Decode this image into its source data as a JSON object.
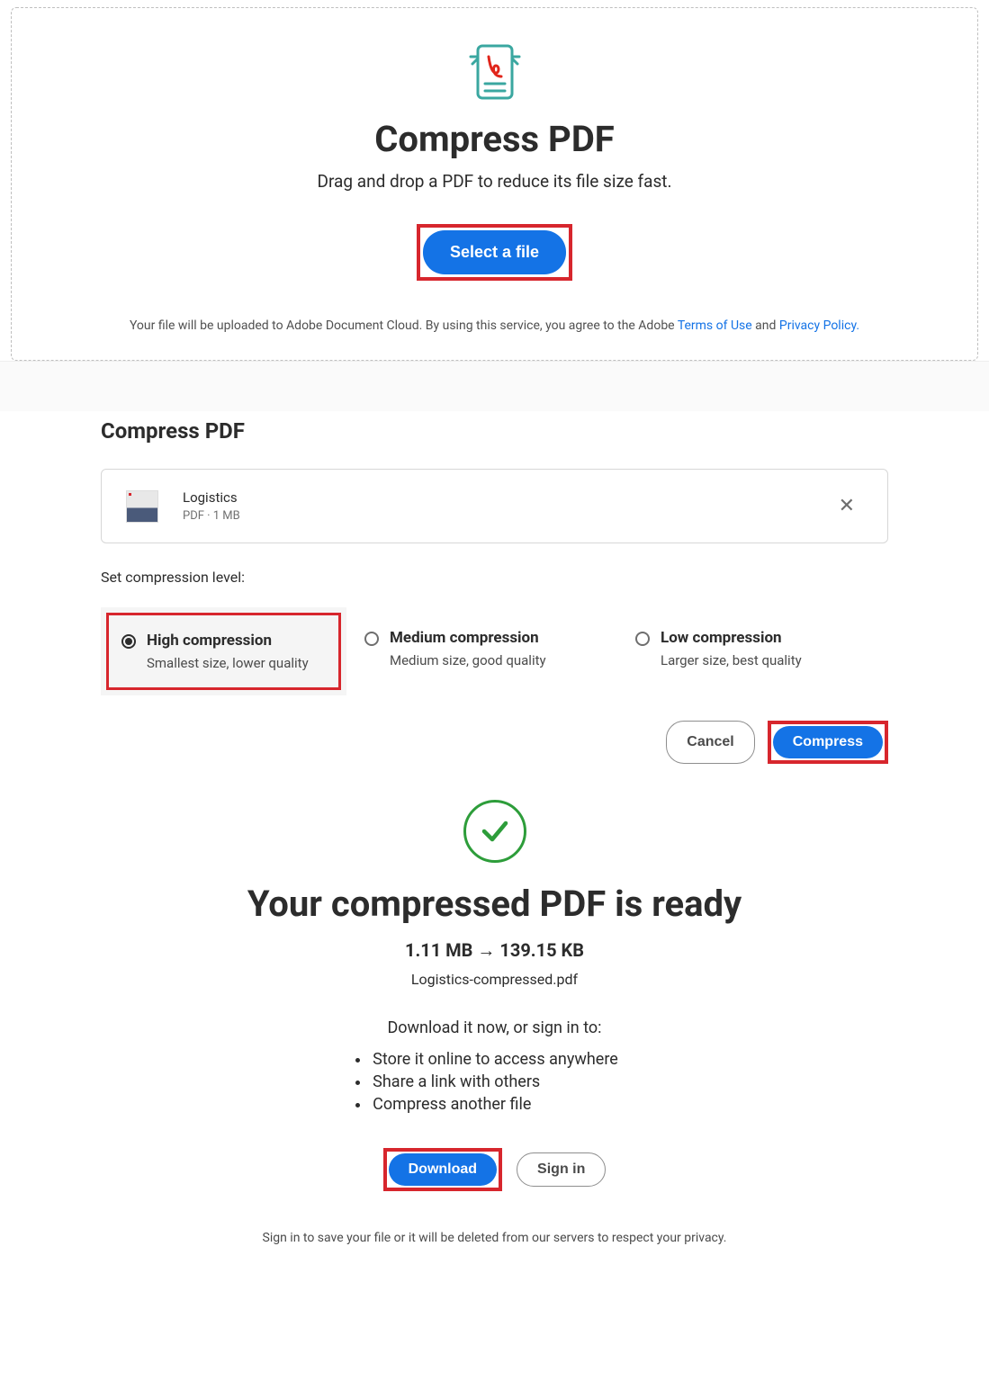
{
  "dropzone": {
    "title": "Compress PDF",
    "subtitle": "Drag and drop a PDF to reduce its file size fast.",
    "select_button": "Select a file",
    "legal_prefix": "Your file will be uploaded to Adobe Document Cloud.   By using this service, you agree to the Adobe ",
    "terms_link": "Terms of Use",
    "legal_and": " and ",
    "privacy_link": "Privacy Policy."
  },
  "settings": {
    "heading": "Compress PDF",
    "file": {
      "name": "Logistics",
      "meta": "PDF · 1 MB"
    },
    "level_label": "Set compression level:",
    "options": [
      {
        "title": "High compression",
        "desc": "Smallest size, lower quality",
        "selected": true
      },
      {
        "title": "Medium compression",
        "desc": "Medium size, good quality",
        "selected": false
      },
      {
        "title": "Low compression",
        "desc": "Larger size, best quality",
        "selected": false
      }
    ],
    "cancel": "Cancel",
    "compress": "Compress"
  },
  "result": {
    "heading": "Your compressed PDF is ready",
    "size_line": "1.11 MB → 139.15 KB",
    "filename": "Logistics-compressed.pdf",
    "prompt": "Download it now, or sign in to:",
    "bullets": [
      "Store it online to access anywhere",
      "Share a link with others",
      "Compress another file"
    ],
    "download": "Download",
    "signin": "Sign in",
    "privacy": "Sign in to save your file or it will be deleted from our servers to respect your privacy."
  }
}
